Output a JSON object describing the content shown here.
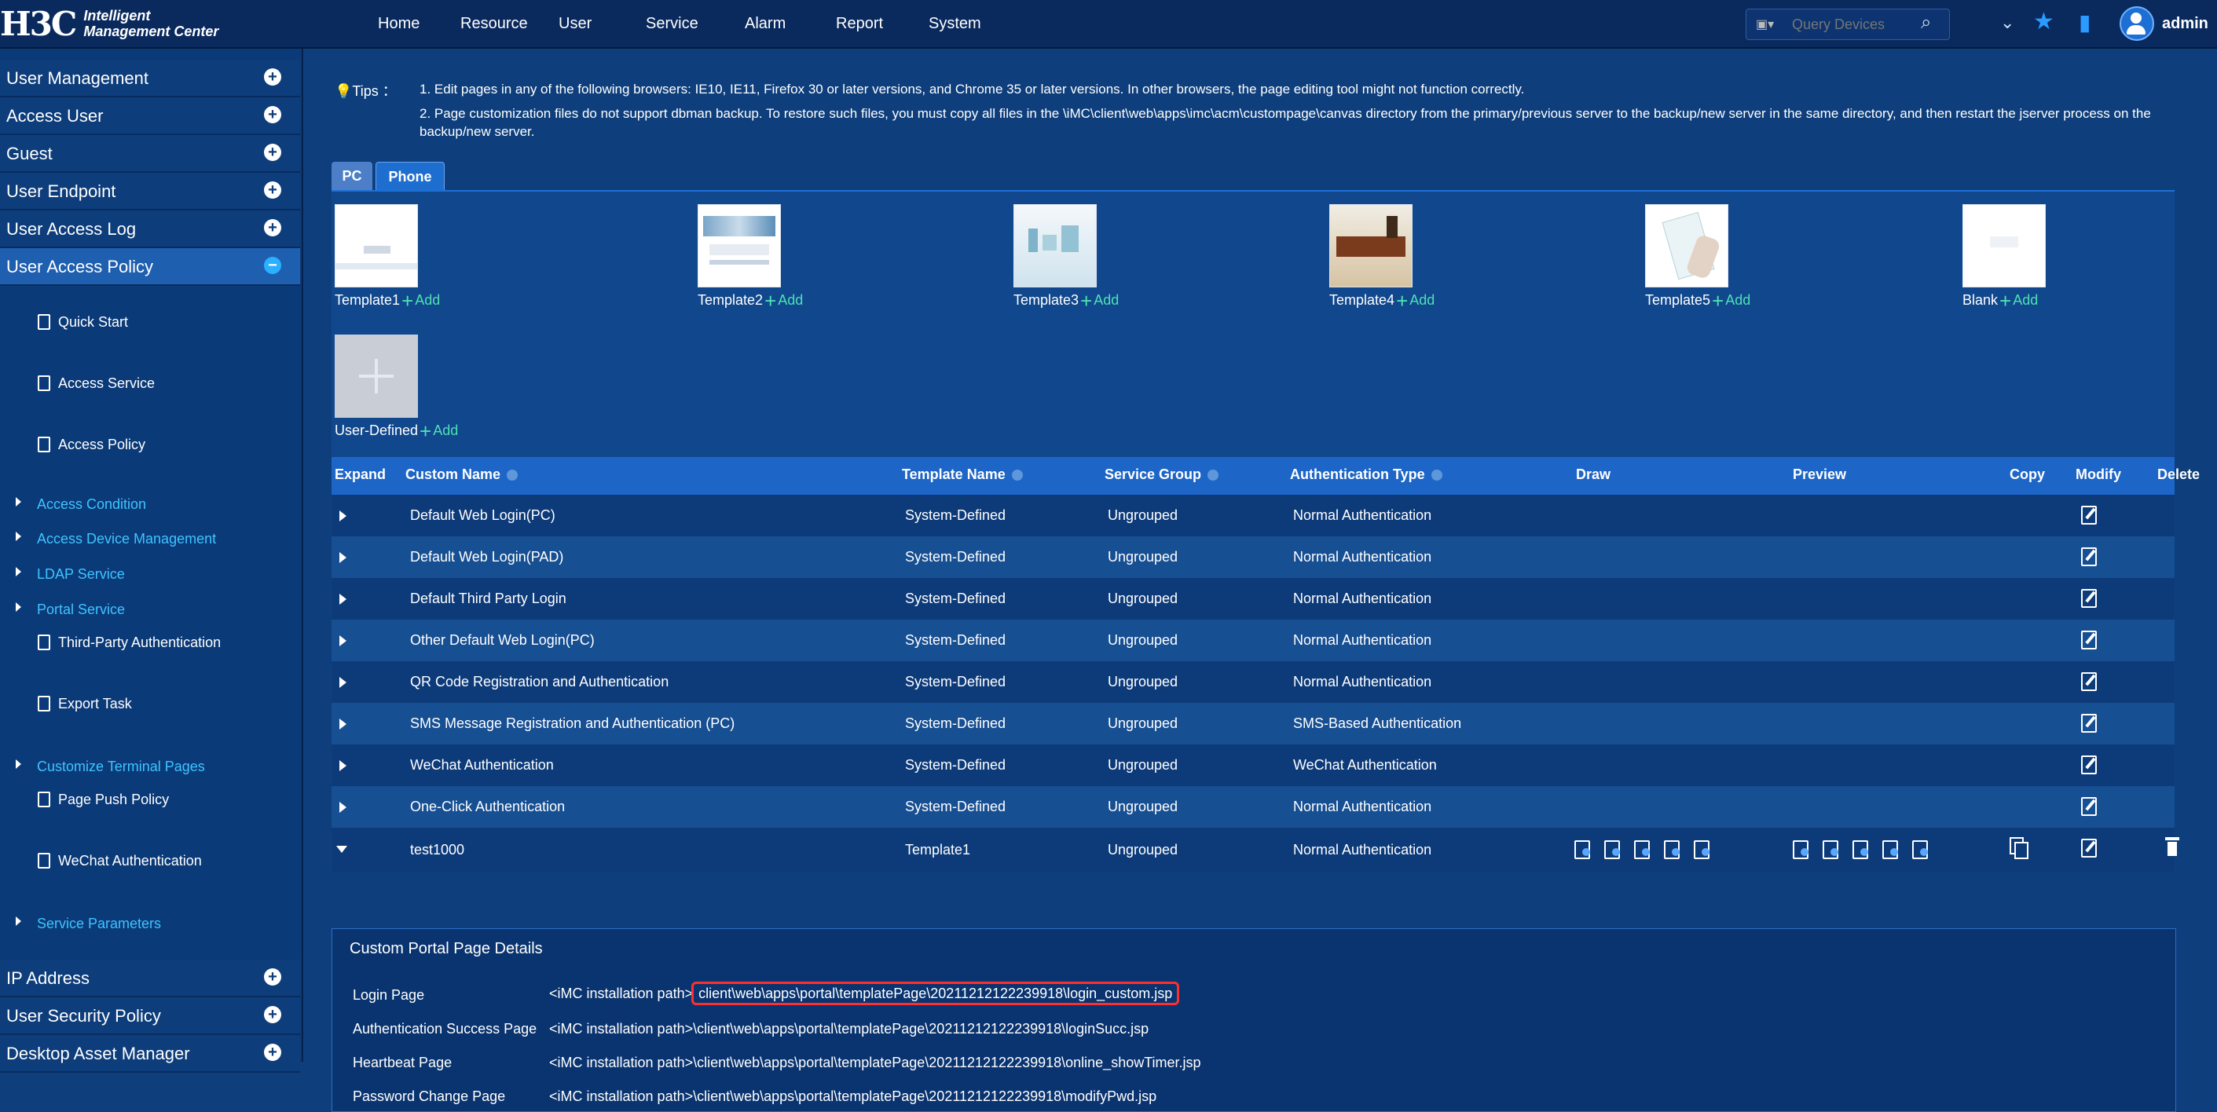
{
  "header": {
    "logo": "H3C",
    "product_line1": "Intelligent",
    "product_line2": "Management Center",
    "nav": [
      "Home",
      "Resource",
      "User",
      "Service",
      "Alarm",
      "Report",
      "System"
    ],
    "search_placeholder": "Query Devices",
    "username": "admin"
  },
  "sidebar": {
    "sections": [
      "User Management",
      "Access User",
      "Guest",
      "User Endpoint",
      "User Access Log",
      "User Access Policy"
    ],
    "sub_items": [
      "Quick Start",
      "Access Service",
      "Access Policy",
      "Third-Party Authentication",
      "Export Task",
      "Page Push Policy",
      "WeChat Authentication"
    ],
    "groups": [
      "Access Condition",
      "Access Device Management",
      "LDAP Service",
      "Portal Service",
      "Customize Terminal Pages",
      "Service Parameters"
    ],
    "bottom_sections": [
      "IP Address",
      "User Security Policy",
      "Desktop Asset Manager"
    ]
  },
  "tips": {
    "label": "Tips ：",
    "line1": "1. Edit pages in any of the following browsers: IE10, IE11, Firefox 30 or later versions, and Chrome 35 or later versions. In other browsers, the page editing tool might not function correctly.",
    "line2": "2. Page customization files do not support dbman backup. To restore such files, you must copy all files in the \\iMC\\client\\web\\apps\\imc\\acm\\custompage\\canvas directory from the primary/previous server to the backup/new server in the same directory, and then restart the jserver process on the backup/new server."
  },
  "tabs": {
    "pc": "PC",
    "phone": "Phone"
  },
  "templates": {
    "add": "Add",
    "items": [
      "Template1",
      "Template2",
      "Template3",
      "Template4",
      "Template5",
      "Blank",
      "User-Defined"
    ]
  },
  "table": {
    "headers": [
      "Expand",
      "Custom Name",
      "Template Name",
      "Service Group",
      "Authentication Type",
      "Draw",
      "Preview",
      "Copy",
      "Modify",
      "Delete"
    ],
    "rows": [
      {
        "name": "Default Web Login(PC)",
        "template": "System-Defined",
        "group": "Ungrouped",
        "auth": "Normal Authentication"
      },
      {
        "name": "Default Web Login(PAD)",
        "template": "System-Defined",
        "group": "Ungrouped",
        "auth": "Normal Authentication"
      },
      {
        "name": "Default Third Party Login",
        "template": "System-Defined",
        "group": "Ungrouped",
        "auth": "Normal Authentication"
      },
      {
        "name": "Other Default Web Login(PC)",
        "template": "System-Defined",
        "group": "Ungrouped",
        "auth": "Normal Authentication"
      },
      {
        "name": "QR Code Registration and Authentication",
        "template": "System-Defined",
        "group": "Ungrouped",
        "auth": "Normal Authentication"
      },
      {
        "name": "SMS Message Registration and Authentication (PC)",
        "template": "System-Defined",
        "group": "Ungrouped",
        "auth": "SMS-Based Authentication"
      },
      {
        "name": "WeChat Authentication",
        "template": "System-Defined",
        "group": "Ungrouped",
        "auth": "WeChat Authentication"
      },
      {
        "name": "One-Click Authentication",
        "template": "System-Defined",
        "group": "Ungrouped",
        "auth": "Normal Authentication"
      },
      {
        "name": "test1000",
        "template": "Template1",
        "group": "Ungrouped",
        "auth": "Normal Authentication"
      }
    ]
  },
  "details": {
    "title": "Custom Portal Page Details",
    "prefix": "<iMC installation path>",
    "rows": [
      {
        "label": "Login Page",
        "path": "client\\web\\apps\\portal\\templatePage\\20211212122239918\\login_custom.jsp"
      },
      {
        "label": "Authentication Success Page",
        "path": "\\client\\web\\apps\\portal\\templatePage\\20211212122239918\\loginSucc.jsp"
      },
      {
        "label": "Heartbeat Page",
        "path": "\\client\\web\\apps\\portal\\templatePage\\20211212122239918\\online_showTimer.jsp"
      },
      {
        "label": "Password Change Page",
        "path": "\\client\\web\\apps\\portal\\templatePage\\20211212122239918\\modifyPwd.jsp"
      }
    ]
  }
}
